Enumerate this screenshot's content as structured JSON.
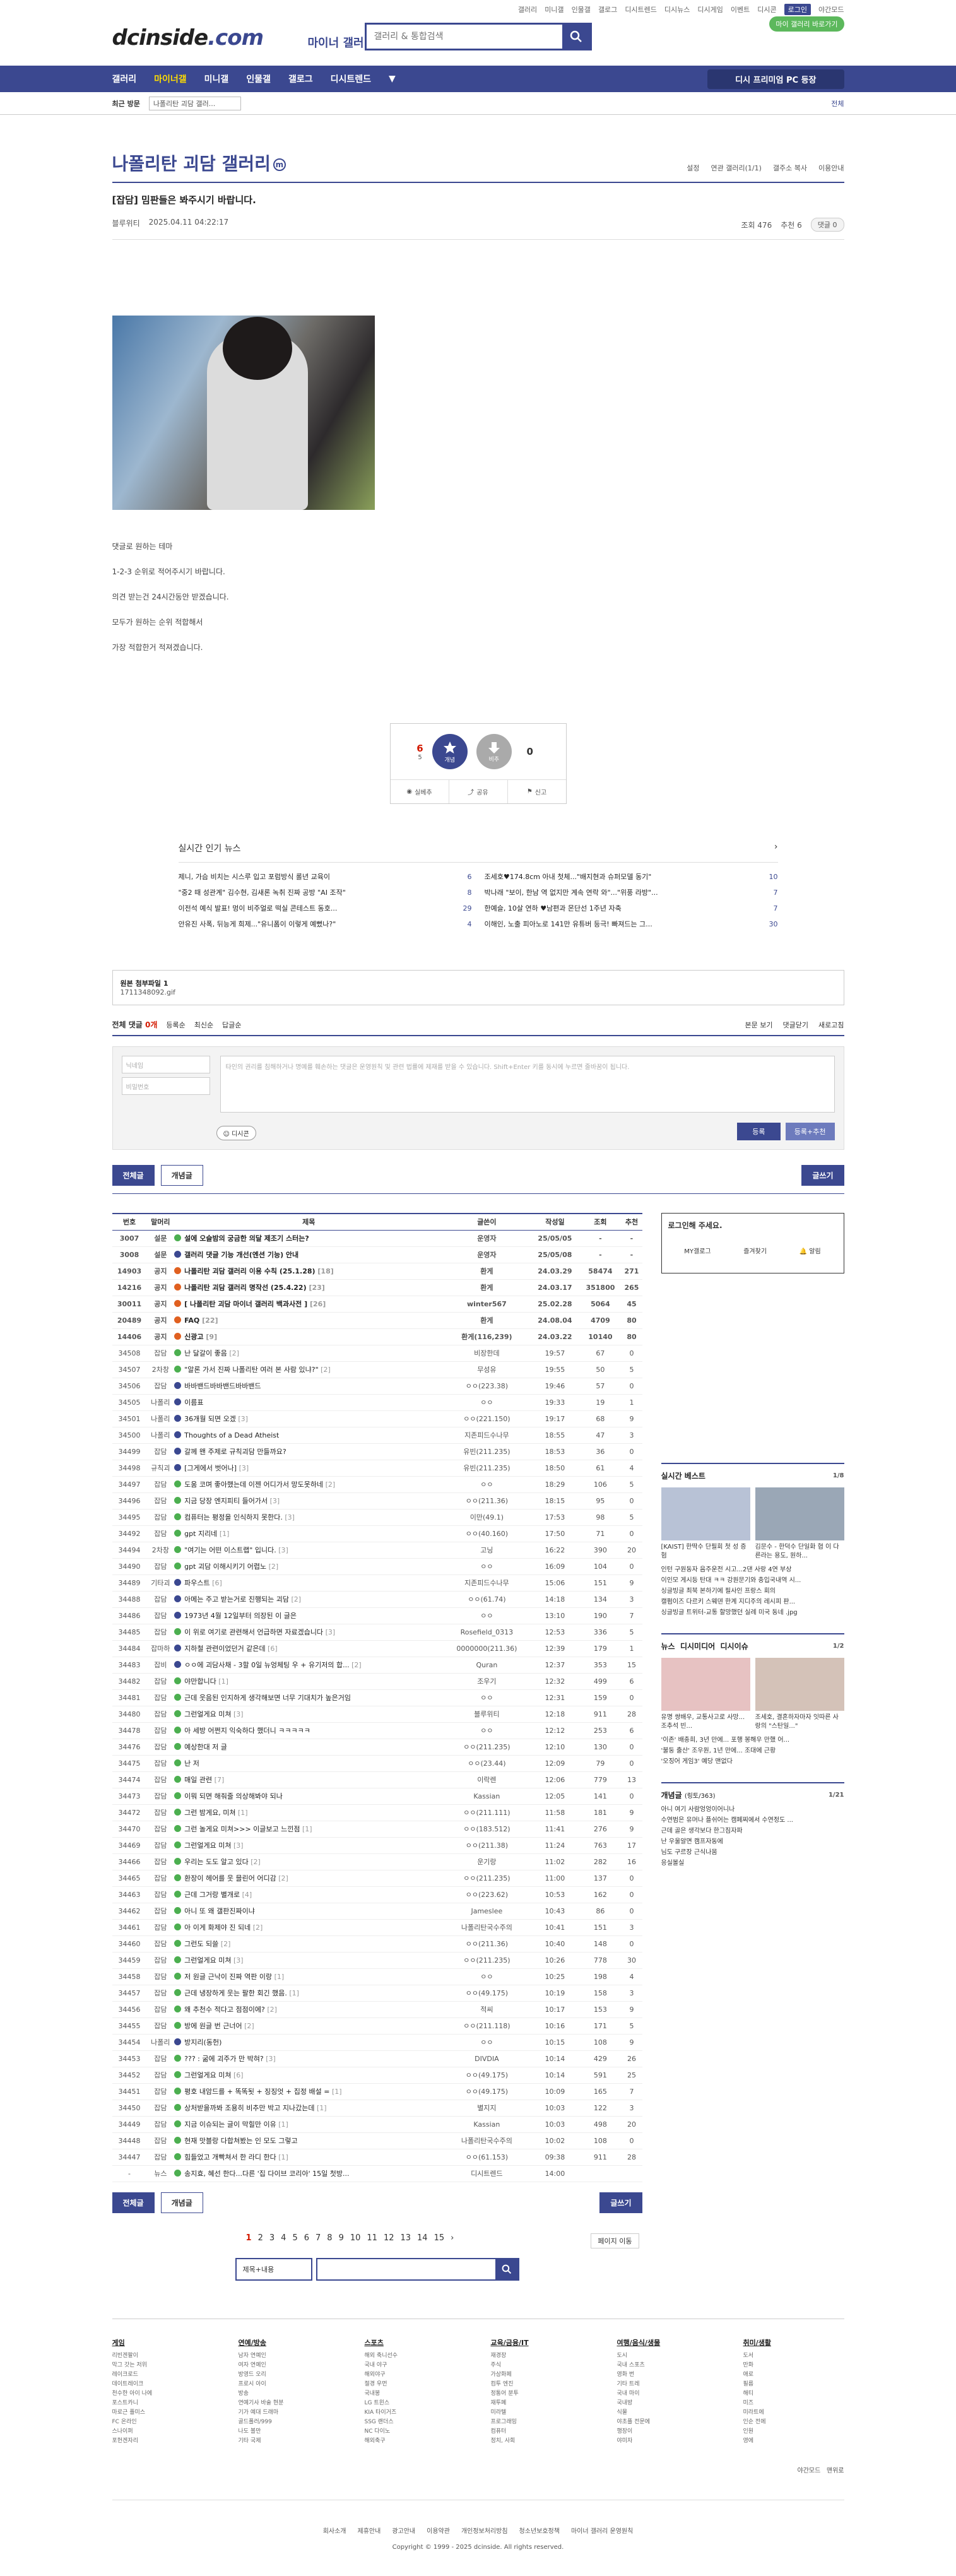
{
  "toplinks": [
    "갤러리",
    "미니갤",
    "인물갤",
    "갤로그",
    "디시트렌드",
    "디시뉴스",
    "디시게임",
    "이벤트",
    "디시콘",
    "로그인",
    "야간모드"
  ],
  "header": {
    "logo_main": "dcinside",
    "logo_dot": ".com",
    "sub": "마이너 갤러리",
    "search_placeholder": "갤러리 & 통합검색",
    "badge": "마이 갤러리 바로가기"
  },
  "gnb": {
    "items": [
      "갤러리",
      "마이너갤",
      "미니갤",
      "인물갤",
      "갤로그",
      "디시트렌드"
    ],
    "dest": "디시 프리미엄 PC 등장"
  },
  "subnav": {
    "recent": "최근 방문",
    "box": "나폴리탄 괴담 갤러...",
    "all": "전체"
  },
  "gallery": {
    "title": "나폴리탄 괴담 갤러리",
    "mark": "m",
    "opts": [
      "설정",
      "연관 갤러리(1/1)",
      "갤주소 복사",
      "이용안내"
    ]
  },
  "post": {
    "title": "[잡담] 밈판들은 봐주시기 바랍니다.",
    "writer": "블루위티",
    "date": "2025.04.11 04:22:17",
    "views": "조회 476",
    "recommend": "추천 6",
    "comments": "댓글 0",
    "body": [
      "댓글로 원하는 테마",
      "1-2-3 순위로 적어주시기 바랍니다.",
      "의견 받는건 24시간동안 받겠습니다.",
      "모두가 원하는 순위 적합해서",
      "가장 적합한거 적져겠습니다."
    ]
  },
  "rec": {
    "up": "6",
    "fixed": "5",
    "down": "0",
    "up_label": "개념",
    "down_label": "비추",
    "share1": "실베추",
    "share2": "공유",
    "share3": "신고"
  },
  "hot": {
    "title": "실시간 인기 뉴스",
    "more": "›",
    "items": [
      [
        "제니, 가슴 비치는 시스루 입고 포럼방식 롤년 교육이",
        "6"
      ],
      [
        "조세호♥174.8cm 아내 첫체...\"배지현과 슈퍼모델 동기\"",
        "10"
      ],
      [
        "\"중2 때 성관계\" 김수현, 김새론 녹취 진짜 공방 \"AI 조작\"",
        "8"
      ],
      [
        "박나래 \"보이, 한남 역 없지만 계속 연락 와\"...\"위풍 라방\"...",
        "7"
      ],
      [
        "이전석 예식 발표! 멍이 비주얼로 떡실 콘테스트 동호...",
        "29"
      ],
      [
        "한예슬, 10살 연하 ♥남편과 몬단선 1주년 자축",
        "7"
      ],
      [
        "안유진 사폭, 뒤능게 희제...\"유니폼이 이렇게 예뻤나?\"",
        "4"
      ],
      [
        "이해인, 노출 피아노로 141만 유튜버 등극! 빠져드는 그...",
        "30"
      ]
    ]
  },
  "attach": {
    "label": "원본 첨부파일 1",
    "file": "1711348092.gif"
  },
  "comment": {
    "all_label": "전체 댓글",
    "count": "0개",
    "sort": [
      "등록순",
      "최신순",
      "답글순"
    ],
    "right": [
      "본문 보기",
      "댓글닫기",
      "새로고침"
    ],
    "id_ph": "닉네임",
    "pw_ph": "비밀번호",
    "ta_ph": "타인의 권리를 침해하거나 명예를 훼손하는 댓글은 운영원칙 및 관련 법률에 제재를 받을 수 있습니다. Shift+Enter 키를 동시에 누르면 줄바꿈이 됩니다.",
    "dccon": "디시콘",
    "submit": "등록",
    "submit2": "등록+추천"
  },
  "buttons": {
    "all": "전체글",
    "concept": "개념글",
    "write": "글쓰기"
  },
  "table": {
    "headers": [
      "번호",
      "말머리",
      "제목",
      "글쓴이",
      "작성일",
      "조회",
      "추천"
    ],
    "rows": [
      [
        "3007",
        "설문",
        "s",
        "설에 오슬밤의 궁금한 의달 제조기 스터는?",
        "",
        "운영자",
        "25/05/05",
        "-",
        "-",
        "n"
      ],
      [
        "3008",
        "설문",
        "n",
        "갤러리 댓글 기능 개선(엔션 기능) 안내",
        "",
        "운영자",
        "25/05/08",
        "-",
        "-",
        "n"
      ],
      [
        "14903",
        "공지",
        "w",
        "나폴리탄 괴담 갤러리 이용 수칙 (25.1.28)",
        "[18]",
        "환게",
        "24.03.29",
        "58474",
        "271",
        "n"
      ],
      [
        "14216",
        "공지",
        "w",
        "나폴리탄 괴담 갤러리 명작선 (25.4.22)",
        "[23]",
        "환게",
        "24.03.17",
        "351800",
        "265",
        "n"
      ],
      [
        "30011",
        "공지",
        "w",
        "[ 나폴리탄 괴담 마이너 갤러리 백과사전 ]",
        "[26]",
        "winter567",
        "25.02.28",
        "5064",
        "45",
        "n"
      ],
      [
        "20489",
        "공지",
        "w",
        "FAQ",
        "[22]",
        "환게",
        "24.08.04",
        "4709",
        "80",
        "n"
      ],
      [
        "14406",
        "공지",
        "w",
        "신광고",
        "[9]",
        "환게(116,239)",
        "24.03.22",
        "10140",
        "80",
        "n"
      ],
      [
        "34508",
        "잡담",
        "s",
        "난 달갈이 좋음",
        "[2]",
        "비장한데",
        "19:57",
        "67",
        "0",
        ""
      ],
      [
        "34507",
        "2차창",
        "s",
        "\"알론 가서 진짜 나폴리탄 여러 본 사람 있냐?\"",
        "[2]",
        "무성유",
        "19:55",
        "50",
        "5",
        ""
      ],
      [
        "34506",
        "잡담",
        "n",
        "바바밴드바바밴드바바밴드",
        "",
        "ㅇㅇ(223.38)",
        "19:46",
        "57",
        "0",
        ""
      ],
      [
        "34505",
        "나폴리",
        "n",
        "이름표",
        "",
        "ㅇㅇ",
        "19:33",
        "19",
        "1",
        ""
      ],
      [
        "34501",
        "나폴리",
        "n",
        "36개월 되면 오겠",
        "[3]",
        "ㅇㅇ(221.150)",
        "19:17",
        "68",
        "9",
        ""
      ],
      [
        "34500",
        "나폴리",
        "n",
        "Thoughts of a Dead Atheist",
        "",
        "지존피드수나무",
        "18:55",
        "47",
        "3",
        ""
      ],
      [
        "34499",
        "잡담",
        "n",
        "갈께 왠 주제로 규칙괴담 만들까요?",
        "",
        "유빈(211.235)",
        "18:53",
        "36",
        "0",
        ""
      ],
      [
        "34498",
        "규칙괴",
        "n",
        "[그게에서 벗어나]",
        "[3]",
        "유빈(211.235)",
        "18:50",
        "61",
        "4",
        ""
      ],
      [
        "34497",
        "잡담",
        "s",
        "도움 코며 좋아했는데 이젠 어디가서 망도못하네",
        "[2]",
        "ㅇㅇ",
        "18:29",
        "106",
        "5",
        ""
      ],
      [
        "34496",
        "잡담",
        "s",
        "지금 당장 엔지피티 들어가서",
        "[3]",
        "ㅇㅇ(211.36)",
        "18:15",
        "95",
        "0",
        ""
      ],
      [
        "34495",
        "잡담",
        "s",
        "컴퓨터는 평정을 인식하지 못한다.",
        "[3]",
        "이만(49.1)",
        "17:53",
        "98",
        "5",
        ""
      ],
      [
        "34492",
        "잡담",
        "s",
        "gpt 지리네",
        "[1]",
        "ㅇㅇ(40.160)",
        "17:50",
        "71",
        "0",
        ""
      ],
      [
        "34494",
        "2차창",
        "s",
        "\"여기는 어떤 이스트랩\" 입니다.",
        "[3]",
        "고닝",
        "16:22",
        "390",
        "20",
        ""
      ],
      [
        "34490",
        "잡담",
        "s",
        "gpt 괴담 이해시키기 어렵노",
        "[2]",
        "ㅇㅇ",
        "16:09",
        "104",
        "0",
        ""
      ],
      [
        "34489",
        "기타괴",
        "n",
        "파우스트",
        "[6]",
        "지존피드수나무",
        "15:06",
        "151",
        "9",
        ""
      ],
      [
        "34488",
        "잡담",
        "n",
        "아메는 주고 받는거로 진행되는 괴담",
        "[2]",
        "ㅇㅇ(61.74)",
        "14:18",
        "134",
        "3",
        ""
      ],
      [
        "34486",
        "잡담",
        "n",
        "1973년 4월 12일부터 의장된 이 글은",
        "",
        "ㅇㅇ",
        "13:10",
        "190",
        "7",
        ""
      ],
      [
        "34485",
        "잡담",
        "s",
        "이 위로 여기로 관련해서 언급하면 자료겠습니다",
        "[3]",
        "Rosefield_0313",
        "12:53",
        "336",
        "5",
        ""
      ],
      [
        "34484",
        "잡마하",
        "n",
        "지하철 관련이었던거 같은데",
        "[6]",
        "0000000(211.36)",
        "12:39",
        "179",
        "1",
        ""
      ],
      [
        "34483",
        "잡비",
        "n",
        "ㅇㅇ에 괴담사채 - 3할 0일 뉴엉체팅 우 + 유기저의 합...",
        "[2]",
        "Quran",
        "12:37",
        "353",
        "15",
        ""
      ],
      [
        "34482",
        "잡담",
        "s",
        "야만합니다",
        "[1]",
        "조우기",
        "12:32",
        "499",
        "6",
        ""
      ],
      [
        "34481",
        "잡담",
        "s",
        "근데 웃음된 인지하게 생각해보면 너무 기대치가 높은거임",
        "",
        "ㅇㅇ",
        "12:31",
        "159",
        "0",
        ""
      ],
      [
        "34480",
        "잡담",
        "s",
        "그런얼게요 미쳐",
        "[3]",
        "블루위티",
        "12:18",
        "911",
        "28",
        ""
      ],
      [
        "34478",
        "잡담",
        "s",
        "아 세방 어쩐지 익숙하다 했더니 ㅋㅋㅋㅋㅋ",
        "",
        "ㅇㅇ",
        "12:12",
        "253",
        "6",
        ""
      ],
      [
        "34476",
        "잡담",
        "s",
        "예상한대 저 글",
        "",
        "ㅇㅇ(211.235)",
        "12:10",
        "130",
        "0",
        ""
      ],
      [
        "34475",
        "잡담",
        "s",
        "난 저",
        "",
        "ㅇㅇ(23.44)",
        "12:09",
        "79",
        "0",
        ""
      ],
      [
        "34474",
        "잡담",
        "s",
        "매일 관련",
        "[7]",
        "이락렌",
        "12:06",
        "779",
        "13",
        ""
      ],
      [
        "34473",
        "잡담",
        "s",
        "이뭐 되면 해줘줄 의상해봐야 되나",
        "",
        "Kassian",
        "12:05",
        "141",
        "0",
        ""
      ],
      [
        "34472",
        "잡담",
        "s",
        "그런 밤게요, 미쳐",
        "[1]",
        "ㅇㅇ(211.111)",
        "11:58",
        "181",
        "9",
        ""
      ],
      [
        "34470",
        "잡담",
        "s",
        "그런 놀게요 미쳐>>> 이글보고 느낀점",
        "[1]",
        "ㅇㅇ(183.512)",
        "11:41",
        "276",
        "9",
        ""
      ],
      [
        "34469",
        "잡담",
        "s",
        "그런얼게요 미쳐",
        "[3]",
        "ㅇㅇ(211.38)",
        "11:24",
        "763",
        "17",
        ""
      ],
      [
        "34466",
        "잡담",
        "s",
        "우리는 도도 알고 있다",
        "[2]",
        "운기랑",
        "11:02",
        "282",
        "16",
        ""
      ],
      [
        "34465",
        "잡담",
        "s",
        "환장이 헤어를 웃 믈린어 어디감",
        "[2]",
        "ㅇㅇ(211.235)",
        "11:00",
        "137",
        "0",
        ""
      ],
      [
        "34463",
        "잡담",
        "s",
        "근데 그거랑 별개로",
        "[4]",
        "ㅇㅇ(223.62)",
        "10:53",
        "162",
        "0",
        ""
      ],
      [
        "34462",
        "잡담",
        "s",
        "아니 또 왜 갤판진짜이냐",
        "",
        "Jameslee",
        "10:43",
        "86",
        "0",
        ""
      ],
      [
        "34461",
        "잡담",
        "s",
        "아 이게 화제야 진 되네",
        "[2]",
        "나폴리탄국수주의",
        "10:41",
        "151",
        "3",
        ""
      ],
      [
        "34460",
        "잡담",
        "s",
        "그런도 되쓸",
        "[2]",
        "ㅇㅇ(211.36)",
        "10:40",
        "148",
        "0",
        ""
      ],
      [
        "34459",
        "잡담",
        "s",
        "그런얼게요 미쳐",
        "[3]",
        "ㅇㅇ(211.235)",
        "10:26",
        "778",
        "30",
        ""
      ],
      [
        "34458",
        "잡담",
        "s",
        "저 원글 근낙이 진짜 역판 이랑",
        "[1]",
        "ㅇㅇ",
        "10:25",
        "198",
        "4",
        ""
      ],
      [
        "34457",
        "잡담",
        "s",
        "근데 냉장하게 웃는 팔한 회긴 했음.",
        "[1]",
        "ㅇㅇ(49.175)",
        "10:19",
        "158",
        "3",
        ""
      ],
      [
        "34456",
        "잡담",
        "s",
        "왜 추천수 적다고 점점이에?",
        "[2]",
        "적씨",
        "10:17",
        "153",
        "9",
        ""
      ],
      [
        "34455",
        "잡담",
        "s",
        "방에 원글 번 근너어",
        "[2]",
        "ㅇㅇ(211.118)",
        "10:16",
        "171",
        "5",
        ""
      ],
      [
        "34454",
        "나폴리",
        "n",
        "방지리(동헌)",
        "",
        "ㅇㅇ",
        "10:15",
        "108",
        "9",
        ""
      ],
      [
        "34453",
        "잡담",
        "s",
        "??? : 굶에 괴주가 만 박혀?",
        "[3]",
        "DIVDIA",
        "10:14",
        "429",
        "26",
        ""
      ],
      [
        "34452",
        "잡담",
        "s",
        "그런얼게요 미쳐",
        "[6]",
        "ㅇㅇ(49.175)",
        "10:14",
        "591",
        "25",
        ""
      ],
      [
        "34451",
        "잡담",
        "s",
        "평호 내암드를 + 똑똑됫 + 징징엇 + 집정 배설 =",
        "[1]",
        "ㅇㅇ(49.175)",
        "10:09",
        "165",
        "7",
        ""
      ],
      [
        "34450",
        "잡담",
        "s",
        "상처받을까봐 조용히 비추만 박고 지나갔는데",
        "[1]",
        "별지지",
        "10:03",
        "122",
        "3",
        ""
      ],
      [
        "34449",
        "잡담",
        "s",
        "지금 이슈되는 글이 막힐만 이유",
        "[1]",
        "Kassian",
        "10:03",
        "498",
        "20",
        ""
      ],
      [
        "34448",
        "잡담",
        "s",
        "현재 맛블랑 다합쳐봤는 인 모도 그렇고",
        "",
        "나폴리탄국수주의",
        "10:02",
        "108",
        "0",
        ""
      ],
      [
        "34447",
        "잡담",
        "s",
        "힘들었고 개빡쳐서 한 라디 한다",
        "[1]",
        "ㅇㅇ(61.153)",
        "09:38",
        "911",
        "28",
        ""
      ],
      [
        "-",
        "뉴스",
        "s",
        "송지효, 혜선 한다...다른 '집 다이브 코리아' 15일 첫방...",
        "",
        "디시트렌드",
        "14:00",
        "",
        "",
        " "
      ]
    ]
  },
  "pager": {
    "pages": [
      "1",
      "2",
      "3",
      "4",
      "5",
      "6",
      "7",
      "8",
      "9",
      "10",
      "11",
      "12",
      "13",
      "14",
      "15"
    ],
    "current": "1",
    "next": "›",
    "move": "페이지 이동"
  },
  "lsearch": {
    "select": "제목+내용"
  },
  "side": {
    "login": "로그인해 주세요.",
    "tabs": [
      "MY갤로그",
      "즐겨찾기",
      "알림"
    ],
    "best": {
      "title": "실시간 베스트",
      "pg": "1/8",
      "items": [
        "[KAIST] 한딱수 단필회 첫 성 증험",
        "김문수 - 한덕수 단일화 협 이 다른라는 용도, 원하..."
      ],
      "list": [
        "인턴 구원동자 음주운전 시고...2댄 사랑 4연 부상",
        "이인모 게시등 탄대 ㅋㅋ 강원문기와 충입국내역 시...",
        "싱글빙글 최북 본하기에 필사인 프랑스 회의",
        "캘펌이즈 다르키 스웨덴 한계 지디주의 레시피 판...",
        "싱글빙글 트위터-교통 할망했던 실례 미국 동네 .jpg"
      ]
    },
    "news": {
      "tabs": [
        "뉴스",
        "디시미디어",
        "디시이슈"
      ],
      "pg": "1/2",
      "items": [
        "유명 쌍배우, 교통사고로 사망... 조추석 빈...",
        "조세호, 결혼하자마자 잇따른 사랑의 \"스탄일...\""
      ],
      "list": [
        "'이존' 배충희, 3년 만에... 포행 봉해우 만했 어...",
        "'불둥 출산' 조우원, 1년 만에... 조대에 근황",
        "'오징어 게임3' 예당 맨없다"
      ]
    },
    "concept": {
      "title": "개념글",
      "sub": "(링토/363)",
      "pg": "1/21",
      "list": [
        "아니 여기 사람엉엉이어니나",
        "수연범은 유머나 플쉬어는 캠페찌에서 수연정도 ...",
        "근데 골은 생각보다 한그짐자파",
        "난 우울알면 캠프자동에",
        "님도 구르장 근식나뭄",
        "응실볼실"
      ]
    }
  },
  "footer": {
    "cols": [
      {
        "h": "게임",
        "l": [
          "리빈겐팔이",
          "막그 갓는 저위",
          "레이크로드",
          "데이트레이크",
          "천수한 아이 나에",
          "포스트카니",
          "마로근 플미스",
          "FC 온라인",
          "스나이퍼",
          "포헌겐자리"
        ]
      },
      {
        "h": "연예/방송",
        "l": [
          "남자 연예인",
          "여자 연예인",
          "방영드 오리",
          "프로시 아이",
          "방송",
          "연예기사 바술 현분",
          "기가 예대 드래마",
          "골드폴러/999",
          "나도 볼만",
          "기타 국제"
        ]
      },
      {
        "h": "스포츠",
        "l": [
          "해외 축니선수",
          "국내 야구",
          "해외야구",
          "절경 우먼",
          "국내봉",
          "LG 트윈스",
          "KIA 타이거즈",
          "SSG 랜더스",
          "NC 다이노",
          "해외축구"
        ]
      },
      {
        "h": "교육/금융/IT",
        "l": [
          "재경장",
          "주식",
          "가상화페",
          "컴투 엔진",
          "정통어 분투",
          "재투폐",
          "미라텔",
          "프로그래밍",
          "컴퓨터",
          "정치, 사회"
        ]
      },
      {
        "h": "여행/음식/생물",
        "l": [
          "도시",
          "국내 스포츠",
          "영화 번",
          "기타 트레",
          "국내 마이",
          "국내방",
          "식물",
          "야초플 전문에",
          "행장이",
          "야미자"
        ]
      },
      {
        "h": "취미/생활",
        "l": [
          "도서",
          "만화",
          "애로",
          "필름",
          "해티",
          "미즈",
          "미라트에",
          "인순 전에",
          "인원",
          "영에"
        ]
      }
    ],
    "night": "야간모드",
    "more": "맨위로",
    "links": [
      "회사소개",
      "제휴안내",
      "광고안내",
      "이용약관",
      "개인정보처리방침",
      "청소년보호정책",
      "마이너 갤러리 운영원칙"
    ],
    "copy": "Copyright © 1999 - 2025 dcinside. All rights reserved."
  }
}
